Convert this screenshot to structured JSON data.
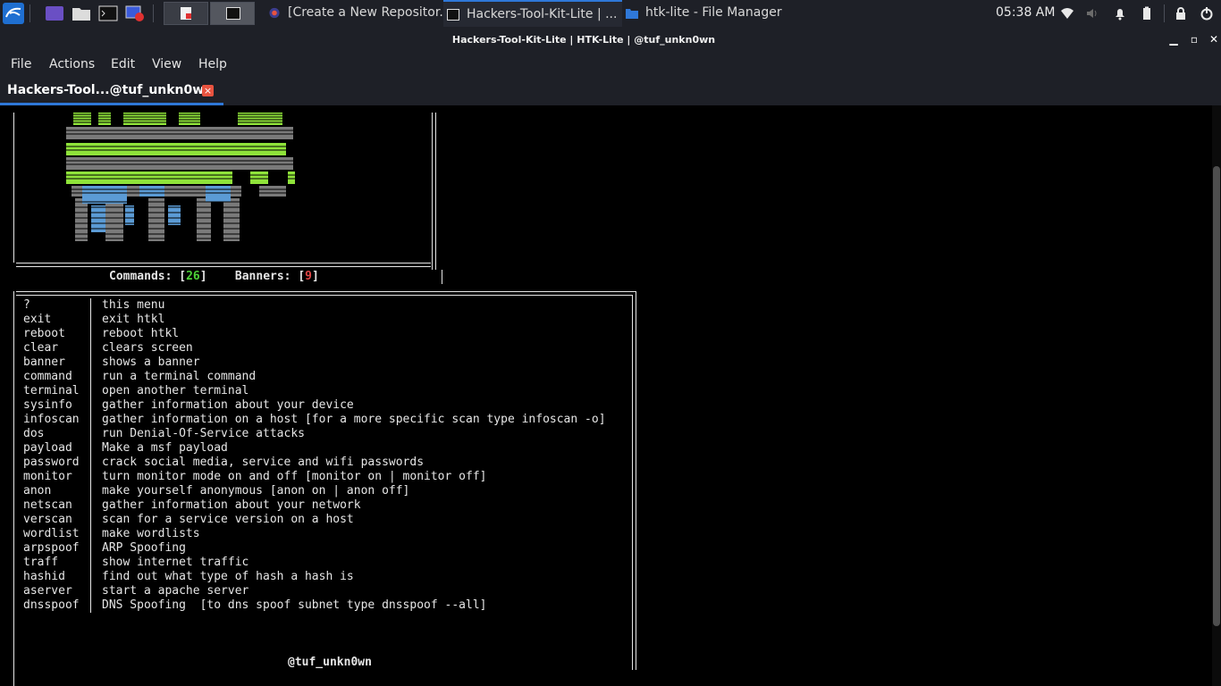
{
  "taskbar": {
    "tasks": [
      {
        "label": "[Create a New Repositor..."
      },
      {
        "label": "Hackers-Tool-Kit-Lite | ..."
      },
      {
        "label": "htk-lite - File Manager"
      }
    ],
    "clock": "05:38 AM"
  },
  "window": {
    "title": "Hackers-Tool-Kit-Lite | HTK-Lite | @tuf_unkn0wn"
  },
  "menu": [
    "File",
    "Actions",
    "Edit",
    "View",
    "Help"
  ],
  "tab": {
    "label": "Hackers-Tool...@tuf_unkn0wn",
    "close": "×"
  },
  "terminal": {
    "counts": {
      "commands_label": "Commands: [",
      "commands_value": "26",
      "banners_label": "]    Banners: [",
      "banners_value": "9",
      "close_bracket": "]"
    },
    "commands": [
      {
        "name": "?",
        "desc": "this menu"
      },
      {
        "name": "exit",
        "desc": "exit htkl"
      },
      {
        "name": "reboot",
        "desc": "reboot htkl"
      },
      {
        "name": "clear",
        "desc": "clears screen"
      },
      {
        "name": "banner",
        "desc": "shows a banner"
      },
      {
        "name": "command",
        "desc": "run a terminal command"
      },
      {
        "name": "terminal",
        "desc": "open another terminal"
      },
      {
        "name": "sysinfo",
        "desc": "gather information about your device"
      },
      {
        "name": "infoscan",
        "desc": "gather information on a host [for a more specific scan type infoscan -o]"
      },
      {
        "name": "dos",
        "desc": "run Denial-Of-Service attacks"
      },
      {
        "name": "payload",
        "desc": "Make a msf payload"
      },
      {
        "name": "password",
        "desc": "crack social media, service and wifi passwords"
      },
      {
        "name": "monitor",
        "desc": "turn monitor mode on and off [monitor on | monitor off]"
      },
      {
        "name": "anon",
        "desc": "make yourself anonymous [anon on | anon off]"
      },
      {
        "name": "netscan",
        "desc": "gather information about your network"
      },
      {
        "name": "verscan",
        "desc": "scan for a service version on a host"
      },
      {
        "name": "wordlist",
        "desc": "make wordlists"
      },
      {
        "name": "arpspoof",
        "desc": "ARP Spoofing"
      },
      {
        "name": "traff",
        "desc": "show internet traffic"
      },
      {
        "name": "hashid",
        "desc": "find out what type of hash a hash is"
      },
      {
        "name": "aserver",
        "desc": "start a apache server"
      },
      {
        "name": "dnsspoof",
        "desc": "DNS Spoofing  [to dns spoof subnet type dnsspoof --all]"
      }
    ],
    "footer": "@tuf_unkn0wn"
  },
  "colors": {
    "accent": "#2f78d8",
    "count_green": "#4cd137",
    "count_red": "#e04646",
    "banner_green": "#8fe33a",
    "banner_blue": "#5b9bd5",
    "banner_gray": "#7a7a7a"
  },
  "icons": [
    "kali-menu-icon",
    "terminal-icon",
    "files-icon",
    "browser-icon",
    "wifi-icon",
    "volume-icon",
    "bell-icon",
    "battery-icon",
    "lock-icon",
    "power-icon"
  ]
}
